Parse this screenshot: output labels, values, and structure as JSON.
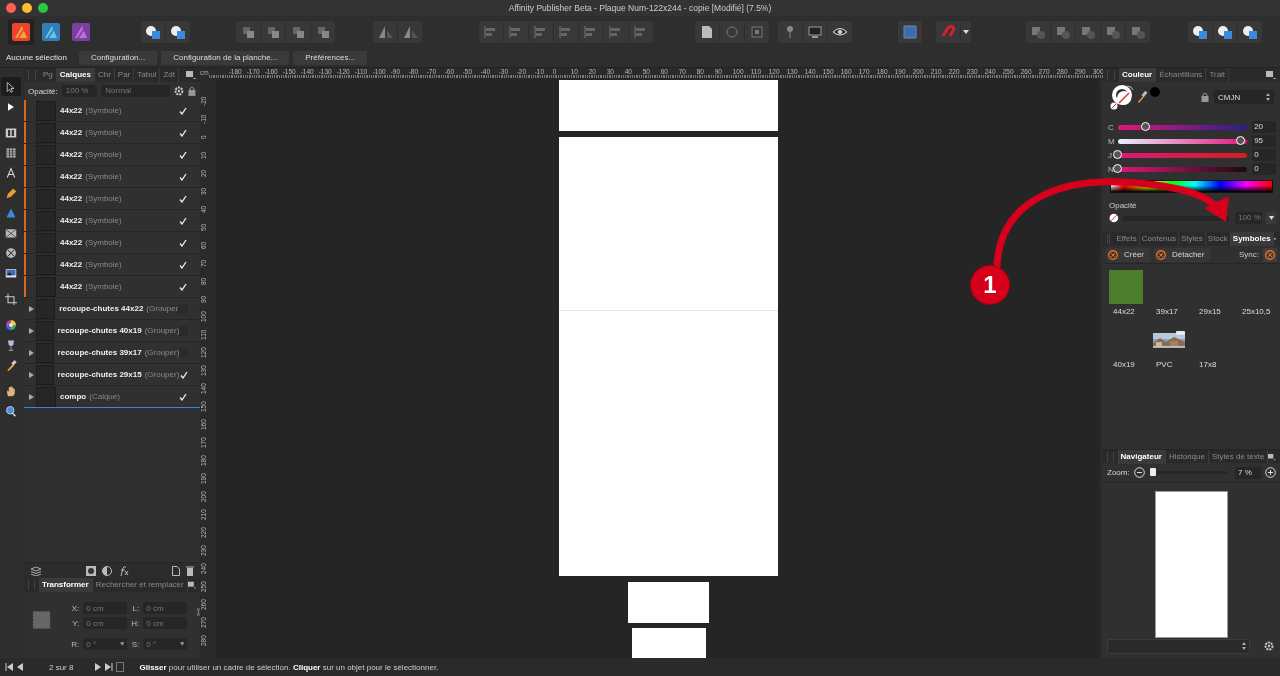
{
  "window": {
    "title": "Affinity Publisher Beta - Plaque Num-122x244 - copie [Modifié] (7.5%)"
  },
  "context_bar": {
    "status": "Aucune sélection",
    "buttons": [
      "Configuration...",
      "Configuration de la planche...",
      "Préférences..."
    ]
  },
  "tools": [
    {
      "selected": true
    },
    {
      "selected": false
    },
    {
      "selected": false
    },
    {
      "selected": false
    },
    {
      "selected": false
    },
    {
      "selected": false
    },
    {
      "selected": false
    },
    {
      "selected": false
    },
    {
      "selected": false
    },
    {
      "selected": false
    },
    {
      "selected": false
    },
    {
      "selected": false
    },
    {
      "selected": false
    },
    {
      "selected": false
    },
    {
      "selected": false
    },
    {
      "selected": false
    }
  ],
  "layers_panel": {
    "tabs": [
      {
        "label": "Pg",
        "selected": false
      },
      {
        "label": "Calques",
        "selected": true
      },
      {
        "label": "Chr",
        "selected": false
      },
      {
        "label": "Par",
        "selected": false
      },
      {
        "label": "Tabul",
        "selected": false
      },
      {
        "label": "Zdt",
        "selected": false
      }
    ],
    "opacity_label": "Opacité:",
    "opacity": "100 %",
    "blend_mode": "Normal",
    "layers": [
      {
        "kind": "symbol",
        "name": "44x22",
        "type": "(Symbole)",
        "visible": true,
        "selected": false
      },
      {
        "kind": "symbol",
        "name": "44x22",
        "type": "(Symbole)",
        "visible": true,
        "selected": false
      },
      {
        "kind": "symbol",
        "name": "44x22",
        "type": "(Symbole)",
        "visible": true,
        "selected": false
      },
      {
        "kind": "symbol",
        "name": "44x22",
        "type": "(Symbole)",
        "visible": true,
        "selected": false
      },
      {
        "kind": "symbol",
        "name": "44x22",
        "type": "(Symbole)",
        "visible": true,
        "selected": false
      },
      {
        "kind": "symbol",
        "name": "44x22",
        "type": "(Symbole)",
        "visible": true,
        "selected": false
      },
      {
        "kind": "symbol",
        "name": "44x22",
        "type": "(Symbole)",
        "visible": true,
        "selected": false
      },
      {
        "kind": "symbol",
        "name": "44x22",
        "type": "(Symbole)",
        "visible": true,
        "selected": false
      },
      {
        "kind": "symbol",
        "name": "44x22",
        "type": "(Symbole)",
        "visible": true,
        "selected": false
      },
      {
        "kind": "group",
        "name": "recoupe-chutes 44x22",
        "type": "(Grouper",
        "visible": false,
        "selected": false
      },
      {
        "kind": "group",
        "name": "recoupe-chutes 40x19",
        "type": "(Grouper)",
        "visible": false,
        "selected": false
      },
      {
        "kind": "group",
        "name": "recoupe-chutes 39x17",
        "type": "(Grouper)",
        "visible": false,
        "selected": false
      },
      {
        "kind": "group",
        "name": "recoupe-chutes 29x15",
        "type": "(Grouper)",
        "visible": true,
        "selected": false
      },
      {
        "kind": "layer",
        "name": "compo",
        "type": "(Calque)",
        "visible": true,
        "selected": true
      }
    ]
  },
  "transform_panel": {
    "tabs": [
      {
        "label": "Transformer",
        "selected": true
      },
      {
        "label": "Rechercher et remplacer",
        "selected": false
      }
    ],
    "fields": [
      {
        "kind": "input",
        "label": "X:",
        "placeholder": "0 cm"
      },
      {
        "kind": "input",
        "label": "L:",
        "placeholder": "0 cm"
      },
      {
        "kind": "input",
        "label": "Y:",
        "placeholder": "0 cm"
      },
      {
        "kind": "input",
        "label": "H:",
        "placeholder": "0 cm"
      },
      {
        "kind": "dropdown",
        "label": "R:",
        "placeholder": "0 °"
      },
      {
        "kind": "dropdown",
        "label": "S:",
        "placeholder": "0 °"
      }
    ]
  },
  "rulers": {
    "unit": "cm",
    "horizontal": [
      "-180",
      "-170",
      "-160",
      "-150",
      "-140",
      "-130",
      "-120",
      "-110",
      "-100",
      "-90",
      "-80",
      "-70",
      "-60",
      "-50",
      "-40",
      "-30",
      "-20",
      "-10",
      "0",
      "10",
      "20",
      "30",
      "40",
      "50",
      "60",
      "70",
      "80",
      "90",
      "100",
      "110",
      "120",
      "130",
      "140",
      "150",
      "160",
      "170",
      "180",
      "190",
      "200",
      "210",
      "220",
      "230",
      "240",
      "250",
      "260",
      "270",
      "280",
      "290",
      "300"
    ],
    "vertical": [
      "-20",
      "-10",
      "0",
      "10",
      "20",
      "30",
      "40",
      "50",
      "60",
      "70",
      "80",
      "90",
      "100",
      "110",
      "120",
      "130",
      "140",
      "150",
      "160",
      "170",
      "180",
      "190",
      "200",
      "210",
      "220",
      "230",
      "240",
      "250",
      "260",
      "270",
      "280"
    ]
  },
  "annotation": {
    "label": "1"
  },
  "color_panel": {
    "tabs": [
      {
        "label": "Couleur",
        "selected": true
      },
      {
        "label": "Échantillons",
        "selected": false
      },
      {
        "label": "Trait",
        "selected": false
      }
    ],
    "model": "CMJN",
    "sliders": [
      {
        "label": "C",
        "level": 0.21,
        "value": "20"
      },
      {
        "label": "M",
        "level": 0.95,
        "value": "95"
      },
      {
        "label": "J",
        "level": 0,
        "value": "0"
      },
      {
        "label": "N",
        "level": 0,
        "value": "0"
      }
    ],
    "opacity_label": "Opacité",
    "opacity": "100 %"
  },
  "studio_tabs": [
    {
      "label": "Effets",
      "selected": false
    },
    {
      "label": "Contenus",
      "selected": false
    },
    {
      "label": "Styles",
      "selected": false
    },
    {
      "label": "Stock",
      "selected": false
    },
    {
      "label": "Symboles",
      "selected": true
    }
  ],
  "symbols_panel": {
    "buttons": [
      "Créer",
      "Détacher"
    ],
    "sync_label": "Sync:",
    "symbols": [
      {
        "kind": "swatch",
        "color": "#4c7d2c",
        "label": "44x22"
      },
      {
        "kind": "empty",
        "label": "39x17"
      },
      {
        "kind": "empty",
        "label": "29x15"
      },
      {
        "kind": "empty",
        "label": "25x10,5"
      },
      {
        "kind": "empty",
        "label": "40x19"
      },
      {
        "kind": "picture",
        "label": "PVC"
      },
      {
        "kind": "empty",
        "label": "17x8"
      }
    ]
  },
  "navigator": {
    "tabs": [
      {
        "label": "Navigateur",
        "selected": true
      },
      {
        "label": "Historique",
        "selected": false
      },
      {
        "label": "Styles de texte",
        "selected": false
      }
    ],
    "zoom_label": "Zoom:",
    "zoom_slider": {
      "level": 0.06
    },
    "zoom": "7 %"
  },
  "status_bar": {
    "page": "2 sur 8",
    "hint": "**Glisser** pour utiliser un cadre de sélection. **Cliquer** sur un objet pour le sélectionner."
  }
}
